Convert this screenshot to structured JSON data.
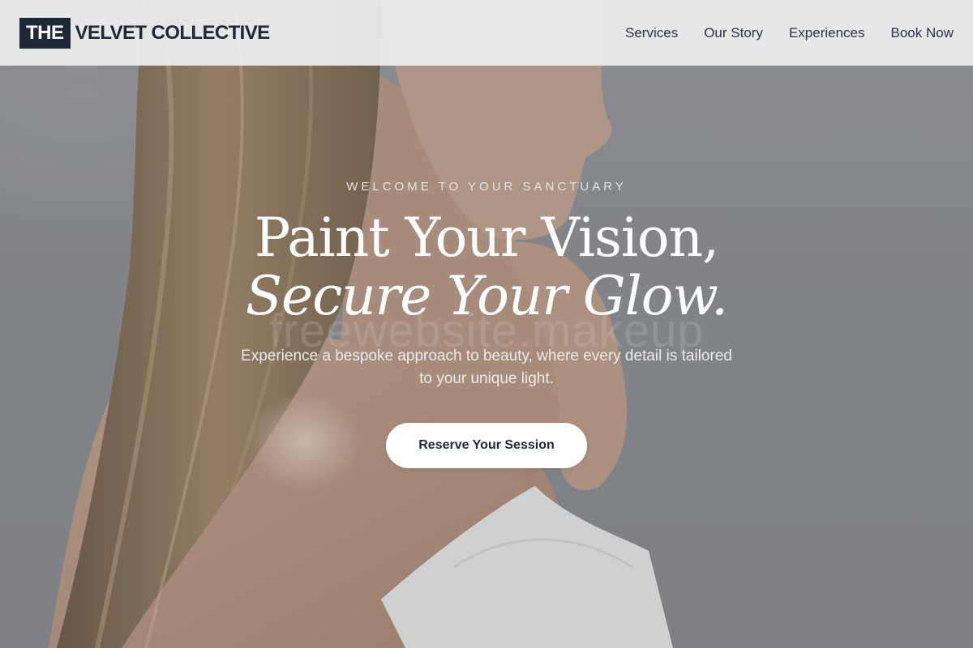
{
  "brand": {
    "logo_box": "THE",
    "logo_text": "VELVET COLLECTIVE"
  },
  "nav": {
    "items": [
      {
        "label": "Services"
      },
      {
        "label": "Our Story"
      },
      {
        "label": "Experiences"
      },
      {
        "label": "Book Now"
      }
    ]
  },
  "hero": {
    "eyebrow": "WELCOME TO YOUR SANCTUARY",
    "headline_line1": "Paint Your Vision,",
    "headline_line2": "Secure Your Glow.",
    "watermark": "freewebsite.makeup",
    "subtext": "Experience a bespoke approach to beauty, where every detail is tailored to your unique light.",
    "cta_label": "Reserve Your Session"
  },
  "colors": {
    "brand_navy": "#1f2839",
    "header_bg": "#eeeef0",
    "hero_gray": "#8d9095",
    "button_bg": "#ffffff"
  }
}
